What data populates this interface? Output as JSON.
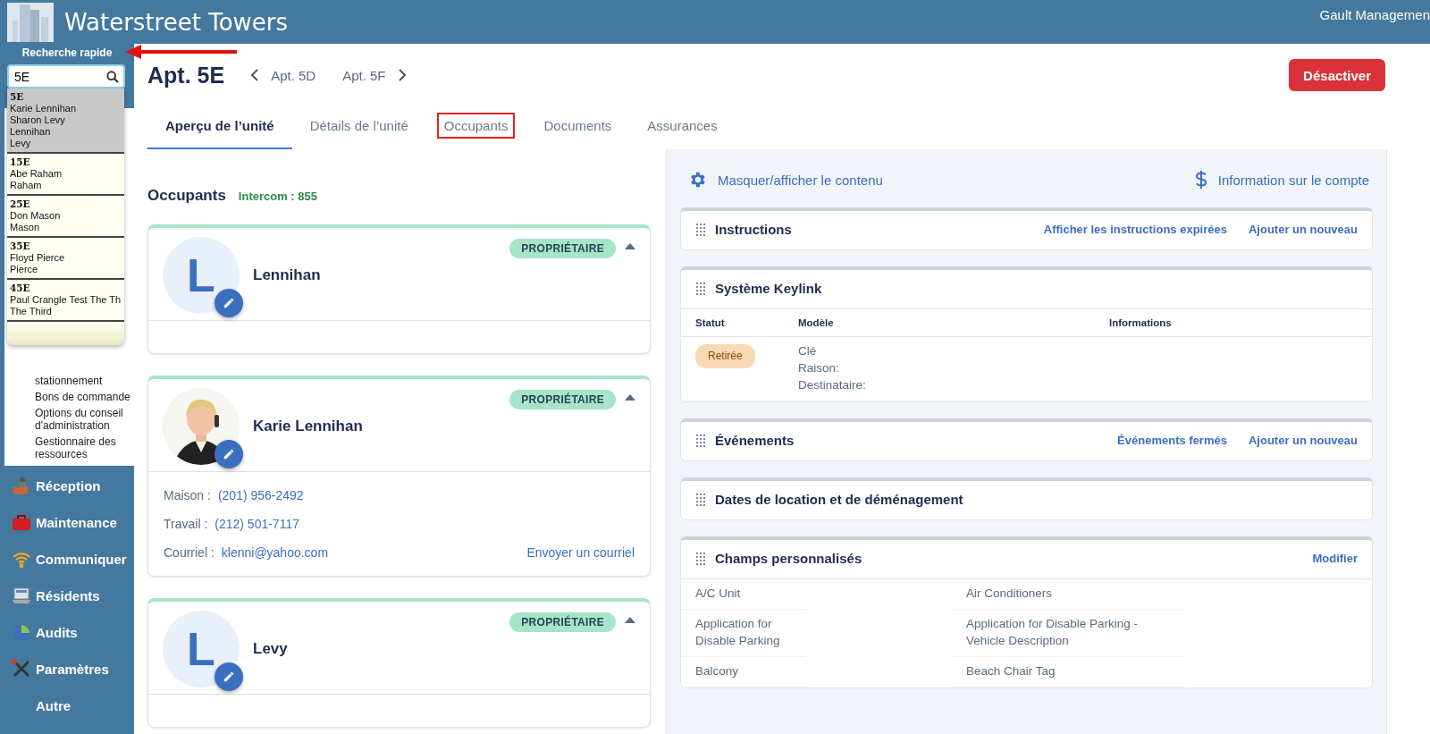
{
  "header": {
    "title": "Waterstreet Towers",
    "account": "Gault Managemen"
  },
  "quick_search": {
    "label": "Recherche rapide",
    "value": "5E"
  },
  "search_results": [
    {
      "unit": "5E",
      "lines": [
        "Karie Lennihan",
        "Sharon Levy",
        "Lennihan",
        "Levy"
      ],
      "selected": true
    },
    {
      "unit": "15E",
      "lines": [
        "Abe Raham",
        "Raham"
      ],
      "selected": false
    },
    {
      "unit": "25E",
      "lines": [
        "Don Mason",
        "Mason"
      ],
      "selected": false
    },
    {
      "unit": "35E",
      "lines": [
        "Floyd Pierce",
        "Pierce"
      ],
      "selected": false
    },
    {
      "unit": "45E",
      "lines": [
        "Paul Crangle Test The Th",
        "The Third"
      ],
      "selected": false
    }
  ],
  "sidebar": {
    "submenu": [
      "stationnement",
      "Bons de commande",
      "Options du conseil d'administration",
      "Gestionnaire des ressources"
    ],
    "menu": [
      {
        "label": "Réception",
        "kind": "desk"
      },
      {
        "label": "Maintenance",
        "kind": "toolbox"
      },
      {
        "label": "Communiquer",
        "kind": "wifi"
      },
      {
        "label": "Résidents",
        "kind": "laptop"
      },
      {
        "label": "Audits",
        "kind": "pie"
      },
      {
        "label": "Paramètres",
        "kind": "tools"
      },
      {
        "label": "Autre",
        "kind": "plain"
      }
    ]
  },
  "unit": {
    "title": "Apt. 5E",
    "previous": "Apt. 5D",
    "next": "Apt. 5F",
    "deactivate": "Désactiver"
  },
  "tabs": [
    {
      "label": "Aperçu de l’unité",
      "selected": true,
      "outlined": false
    },
    {
      "label": "Détails de l’unité",
      "selected": false,
      "outlined": false
    },
    {
      "label": "Occupants",
      "selected": false,
      "outlined": true
    },
    {
      "label": "Documents",
      "selected": false,
      "outlined": false
    },
    {
      "label": "Assurances",
      "selected": false,
      "outlined": false
    }
  ],
  "occupants": {
    "title": "Occupants",
    "intercom": "Intercom : 855",
    "cards": [
      {
        "name": "Lennihan",
        "avatar": {
          "kind": "initial",
          "initial": "L"
        },
        "role": "PROPRIÉTAIRE",
        "expanded": true
      },
      {
        "name": "Karie Lennihan",
        "avatar": {
          "kind": "picture"
        },
        "role": "PROPRIÉTAIRE",
        "expanded": true,
        "contacts": [
          {
            "label": "Maison :",
            "value": "(201) 956-2492"
          },
          {
            "label": "Travail :",
            "value": "(212) 501-7117"
          },
          {
            "label": "Courriel :",
            "value": "klenni@yahoo.com"
          }
        ],
        "action": "Envoyer un courriel"
      },
      {
        "name": "Levy",
        "avatar": {
          "kind": "initial",
          "initial": "L"
        },
        "role": "PROPRIÉTAIRE",
        "expanded": true
      }
    ]
  },
  "panel": {
    "toolbar": [
      {
        "label": "Masquer/afficher le contenu",
        "kind": "settings"
      },
      {
        "label": "Information sur le compte",
        "kind": "account"
      }
    ],
    "sections": [
      {
        "kind": "plain",
        "title": "Instructions",
        "actions": [
          "Afficher les instructions expirées",
          "Ajouter un nouveau"
        ]
      },
      {
        "kind": "keylink",
        "title": "Système Keylink",
        "columns": [
          "Statut",
          "Modèle",
          "Informations"
        ],
        "rows": [
          {
            "status": "Retirée",
            "model": [
              "Clé",
              "Raison:",
              "Destinataire:"
            ]
          }
        ]
      },
      {
        "kind": "plain",
        "title": "Événements",
        "actions": [
          "Événements fermés",
          "Ajouter un nouveau"
        ]
      },
      {
        "kind": "plain",
        "title": "Dates de location et de déménagement"
      },
      {
        "kind": "fields",
        "title": "Champs personnalisés",
        "actions": [
          "Modifier"
        ],
        "rows": [
          [
            "A/C Unit",
            "Air Conditioners"
          ],
          [
            "Application for Disable Parking",
            "Application for Disable Parking - Vehicle Description"
          ],
          [
            "Balcony",
            "Beach Chair Tag"
          ]
        ]
      }
    ]
  }
}
